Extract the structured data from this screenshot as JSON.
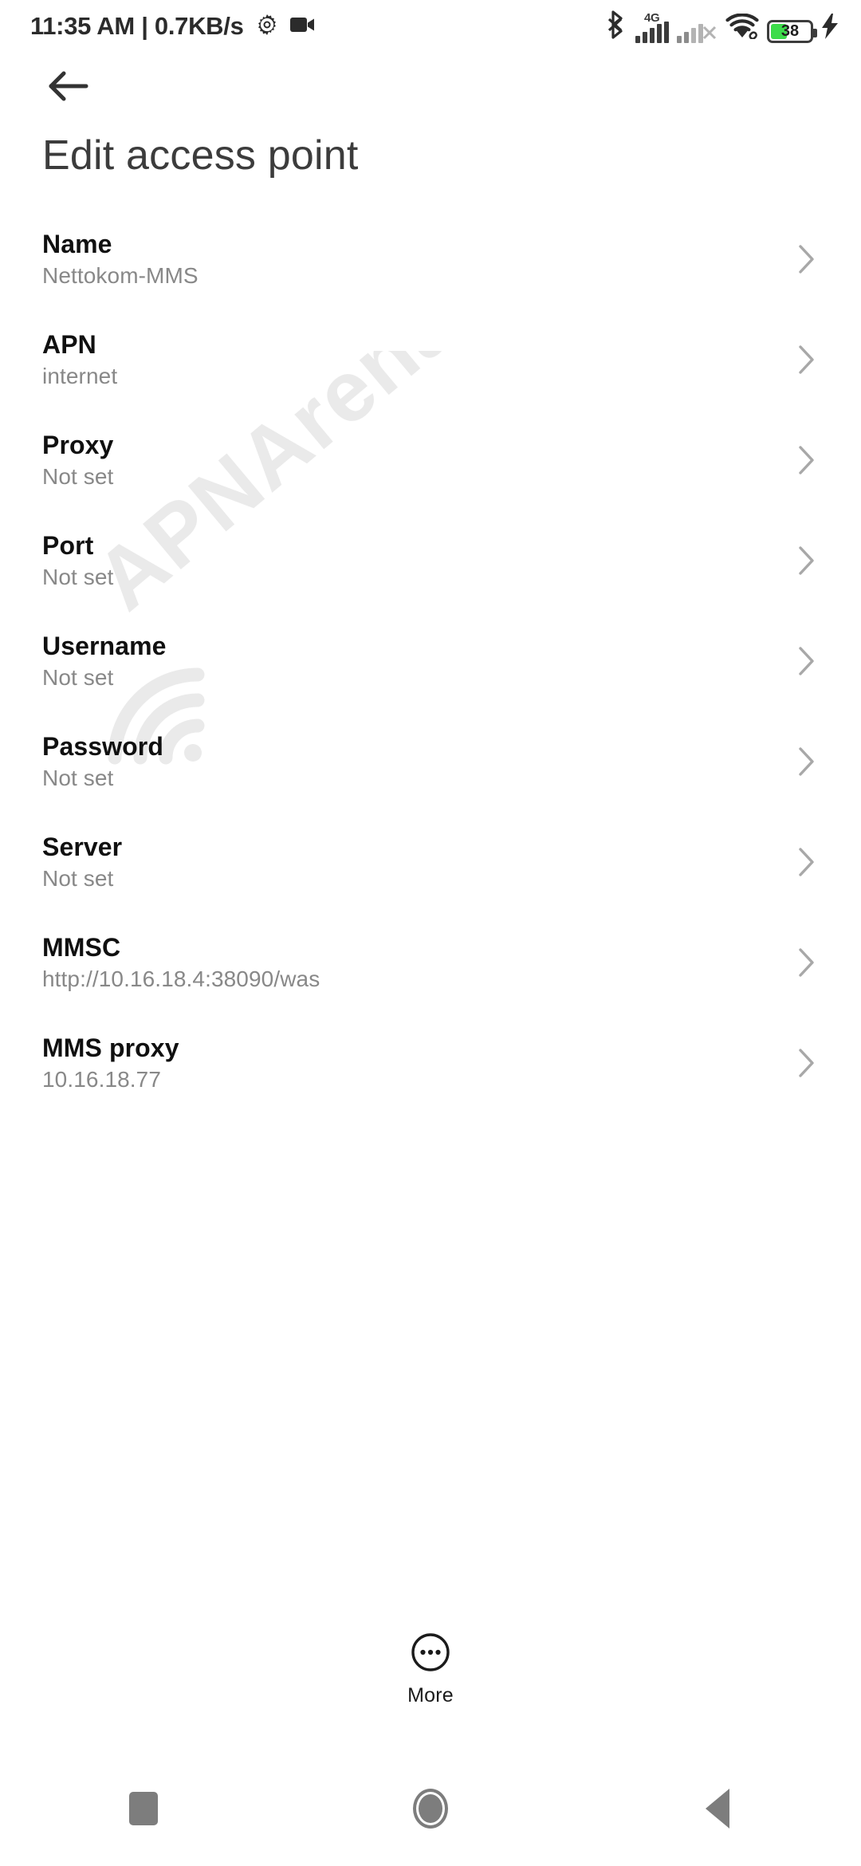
{
  "status_bar": {
    "time": "11:35 AM",
    "separator": "|",
    "network_speed": "0.7KB/s",
    "gear_icon": "gear-icon",
    "camera_icon": "video-camera-icon",
    "bluetooth_icon": "bluetooth-icon",
    "sim1_network_type": "4G",
    "sim1_icon": "signal-bars-icon",
    "sim2_icon": "signal-bars-no-service-icon",
    "wifi_icon": "wifi-icon",
    "battery_level": "38",
    "battery_icon": "battery-icon",
    "charging_icon": "lightning-bolt-icon",
    "battery_color": "#3ddc4b"
  },
  "header": {
    "back_icon": "back-arrow-icon",
    "title": "Edit access point"
  },
  "watermark": {
    "text": "APNArena",
    "color": "#ececec"
  },
  "settings": {
    "rows": [
      {
        "title": "Name",
        "value": "Nettokom-MMS"
      },
      {
        "title": "APN",
        "value": "internet"
      },
      {
        "title": "Proxy",
        "value": "Not set"
      },
      {
        "title": "Port",
        "value": "Not set"
      },
      {
        "title": "Username",
        "value": "Not set"
      },
      {
        "title": "Password",
        "value": "Not set"
      },
      {
        "title": "Server",
        "value": "Not set"
      },
      {
        "title": "MMSC",
        "value": "http://10.16.18.4:38090/was"
      },
      {
        "title": "MMS proxy",
        "value": "10.16.18.77"
      }
    ],
    "chevron_icon": "chevron-right-icon"
  },
  "more_button": {
    "label": "More",
    "icon": "more-circle-icon"
  },
  "nav_bar": {
    "recents_icon": "recents-square-icon",
    "home_icon": "home-circle-icon",
    "back_icon": "back-triangle-icon",
    "color": "#7d7d7d"
  }
}
